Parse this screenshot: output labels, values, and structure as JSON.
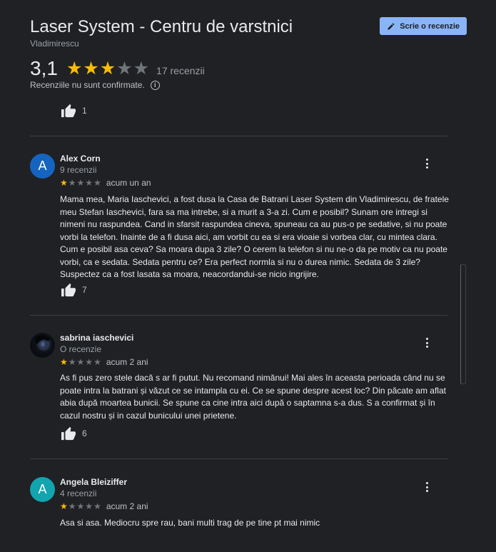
{
  "header": {
    "title": "Laser System - Centru de varstnici",
    "location": "Vladimirescu",
    "write_review_label": "Scrie o recenzie"
  },
  "summary": {
    "rating": "3,1",
    "rating_value": 3.1,
    "stars_filled": 3,
    "stars_total": 5,
    "review_count": "17 recenzii",
    "unconfirmed_notice": "Recenziile nu sunt confirmate."
  },
  "previous_review": {
    "likes": "1"
  },
  "reviews": [
    {
      "author": "Alex Corn",
      "initial": "A",
      "avatar_color": "#1a73e8",
      "review_count": "9 recenzii",
      "stars": 1,
      "date": "acum un an",
      "text": "Mama mea, Maria Iaschevici, a fost dusa la Casa de Batrani Laser  System din Vladimirescu, de fratele meu Stefan Iaschevici,  fara sa ma intrebe, si a murit a 3-a zi. Cum e posibil? Sunam ore intregi si nimeni nu raspundea. Cand in sfarsit raspundea cineva, spuneau ca au pus-o pe sedative, si nu poate vorbi la telefon. Inainte de a fi dusa  aici, am vorbit cu ea si era vioaie si vorbea clar, cu mintea clara. Cum e posibil asa ceva? Sa moara dupa 3 zile? O cerem la telefon si nu ne-o da pe motiv ca nu poate vorbi, ca e sedata. Sedata pentru ce? Era perfect normla si nu o durea nimic. Sedata de 3 zile? Suspectez ca a fost lasata sa moara, neacordandui-se nicio ingrijire.",
      "likes": "7"
    },
    {
      "author": "sabrina iaschevici",
      "initial": "",
      "avatar_color": "#0b0e14",
      "review_count": "O recenzie",
      "stars": 1,
      "date": "acum 2 ani",
      "text": "As fi pus zero stele dacă s ar fi putut. Nu recomand nimănui! Mai ales în aceasta perioada când nu se poate intra la batrani și văzut ce se intampla cu ei. Ce se spune despre acest loc? Din păcate am aflat abia după moartea bunicii. Se spune ca cine intra aici după o saptamna s-a dus. S a confirmat și în cazul nostru și in cazul bunicului unei prietene.",
      "likes": "6"
    },
    {
      "author": "Angela Bleiziffer",
      "initial": "A",
      "avatar_color": "#12a4af",
      "review_count": "4 recenzii",
      "stars": 1,
      "date": "acum 2 ani",
      "text": "Asa si asa. Mediocru spre rau, bani multi trag de pe tine pt mai nimic",
      "likes": ""
    }
  ],
  "colors": {
    "star_on": "#fbbc04",
    "star_off": "#70757a",
    "accent": "#8ab4f8"
  }
}
